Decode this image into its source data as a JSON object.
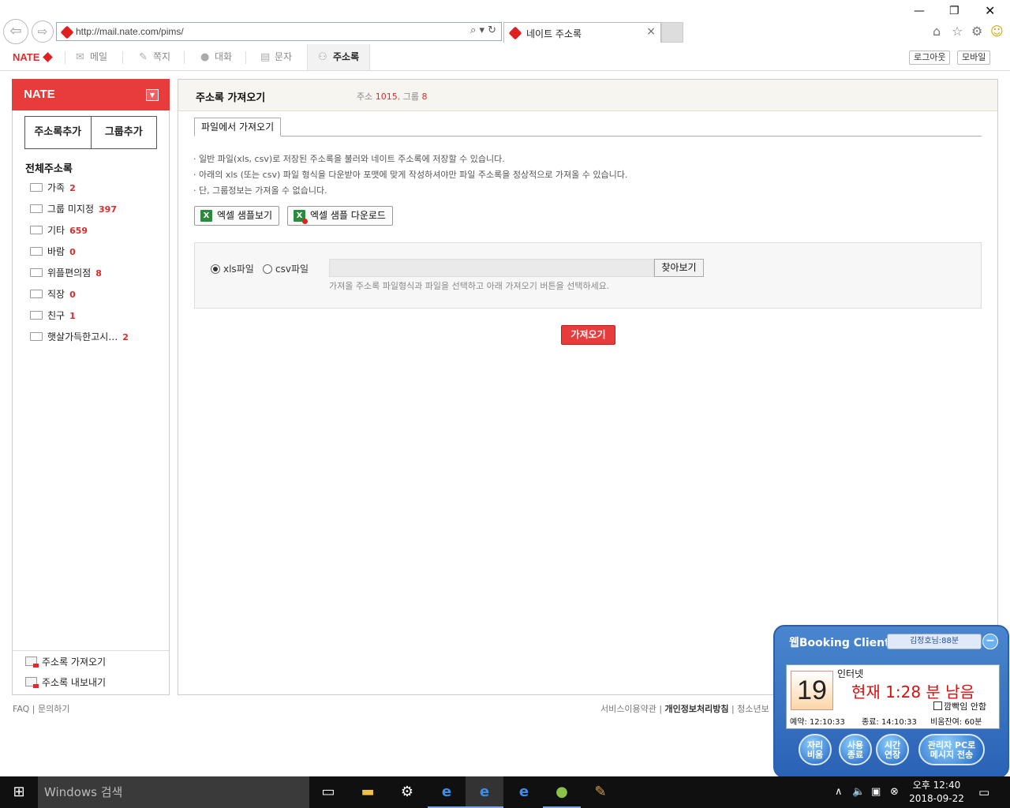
{
  "browser": {
    "url": "http://mail.nate.com/pims/",
    "tab_title": "네이트 주소록"
  },
  "nav": {
    "logo": "NATE",
    "items": [
      {
        "label": "메일",
        "icon": "mail-icon",
        "active": false
      },
      {
        "label": "쪽지",
        "icon": "note-icon",
        "active": false
      },
      {
        "label": "대화",
        "icon": "chat-icon",
        "active": false
      },
      {
        "label": "문자",
        "icon": "sms-icon",
        "active": false
      },
      {
        "label": "주소록",
        "icon": "person-icon",
        "active": true
      }
    ],
    "logout": "로그아웃",
    "mobile": "모바일"
  },
  "sidebar": {
    "logo": "NATE",
    "add_contact": "주소록추가",
    "add_group": "그룹추가",
    "all_contacts": "전체주소록",
    "groups": [
      {
        "name": "가족",
        "count": "2"
      },
      {
        "name": "그룹 미지정",
        "count": "397"
      },
      {
        "name": "기타",
        "count": "659"
      },
      {
        "name": "바람",
        "count": "0"
      },
      {
        "name": "위플편의점",
        "count": "8"
      },
      {
        "name": "직장",
        "count": "0"
      },
      {
        "name": "친구",
        "count": "1"
      },
      {
        "name": "햇살가득한고시…",
        "count": "2"
      }
    ],
    "import": "주소록 가져오기",
    "export": "주소록 내보내기"
  },
  "main": {
    "title": "주소록 가져오기",
    "stats_label_addr": "주소",
    "stats_addr": "1015",
    "stats_label_group": "그룹",
    "stats_group": "8",
    "tab": "파일에서 가져오기",
    "info": [
      "· 일반 파일(xls, csv)로 저장된 주소록을 불러와 네이트 주소록에 저장할 수 있습니다.",
      "· 아래의 xls (또는 csv) 파일 형식을 다운받아 포맷에 맞게 작성하셔야만 파일 주소록을 정상적으로 가져올 수 있습니다.",
      "· 단, 그룹정보는 가져올 수 없습니다."
    ],
    "excel_view": "엑셀 샘플보기",
    "excel_download": "엑셀 샘플 다운로드",
    "radio_xls": "xls파일",
    "radio_csv": "csv파일",
    "browse": "찾아보기",
    "help": "가져올 주소록 파일형식과 파일을 선택하고 아래 가져오기 버튼을 선택하세요.",
    "import_button": "가져오기"
  },
  "footer": {
    "faq": "FAQ",
    "contact": "문의하기",
    "terms": "서비스이용약관",
    "privacy": "개인정보처리방침",
    "youth": "청소년보"
  },
  "booking": {
    "title": "웹Booking Client",
    "user": "김정호님:88분",
    "seat": "19",
    "seat_type": "인터넷",
    "remaining": "현재 1:28 분 남음",
    "no_blink": "깜빡임 안함",
    "reserve": "예약: 12:10:33",
    "end": "종료: 14:10:33",
    "empty_remaining": "비움잔여: 60분",
    "btn_empty": [
      "자리",
      "비움"
    ],
    "btn_finish": [
      "사용",
      "종료"
    ],
    "btn_extend": [
      "시간",
      "연장"
    ],
    "btn_message": [
      "관리자 PC로",
      "메시지 전송"
    ]
  },
  "taskbar": {
    "search": "Windows 검색",
    "time": "오후 12:40",
    "date": "2018-09-22"
  }
}
